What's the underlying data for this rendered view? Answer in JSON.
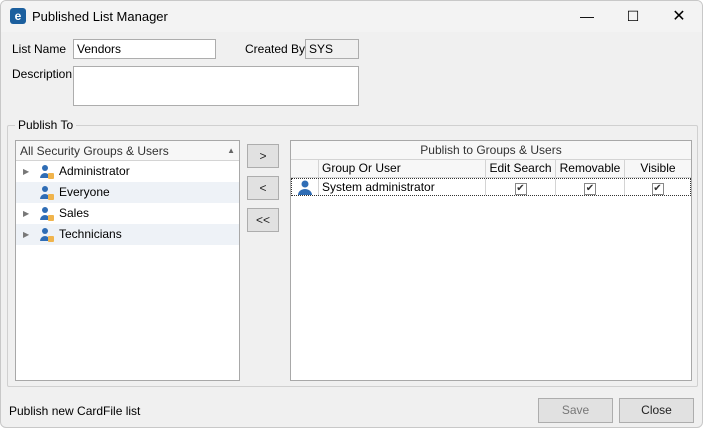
{
  "window": {
    "title": "Published List Manager",
    "app_icon": "app-logo-icon",
    "controls": [
      "minimize",
      "maximize",
      "close"
    ]
  },
  "form": {
    "list_name_label": "List Name",
    "list_name_value": "Vendors",
    "created_by_label": "Created By",
    "created_by_value": "SYS",
    "description_label": "Description",
    "description_value": ""
  },
  "publish_to": {
    "label": "Publish To",
    "tree": {
      "header": "All Security Groups & Users",
      "items": [
        {
          "label": "Administrator",
          "expandable": true
        },
        {
          "label": "Everyone",
          "expandable": false
        },
        {
          "label": "Sales",
          "expandable": true
        },
        {
          "label": "Technicians",
          "expandable": true
        }
      ]
    },
    "buttons": {
      "add": ">",
      "remove": "<",
      "remove_all": "<<"
    },
    "grid": {
      "title": "Publish to Groups & Users",
      "columns": [
        "Group Or User",
        "Edit Search",
        "Removable",
        "Visible"
      ],
      "rows": [
        {
          "name": "System administrator",
          "edit_search": true,
          "removable": true,
          "visible": true
        }
      ]
    }
  },
  "footer": {
    "status": "Publish new CardFile list",
    "save": "Save",
    "close": "Close",
    "save_enabled": false
  }
}
